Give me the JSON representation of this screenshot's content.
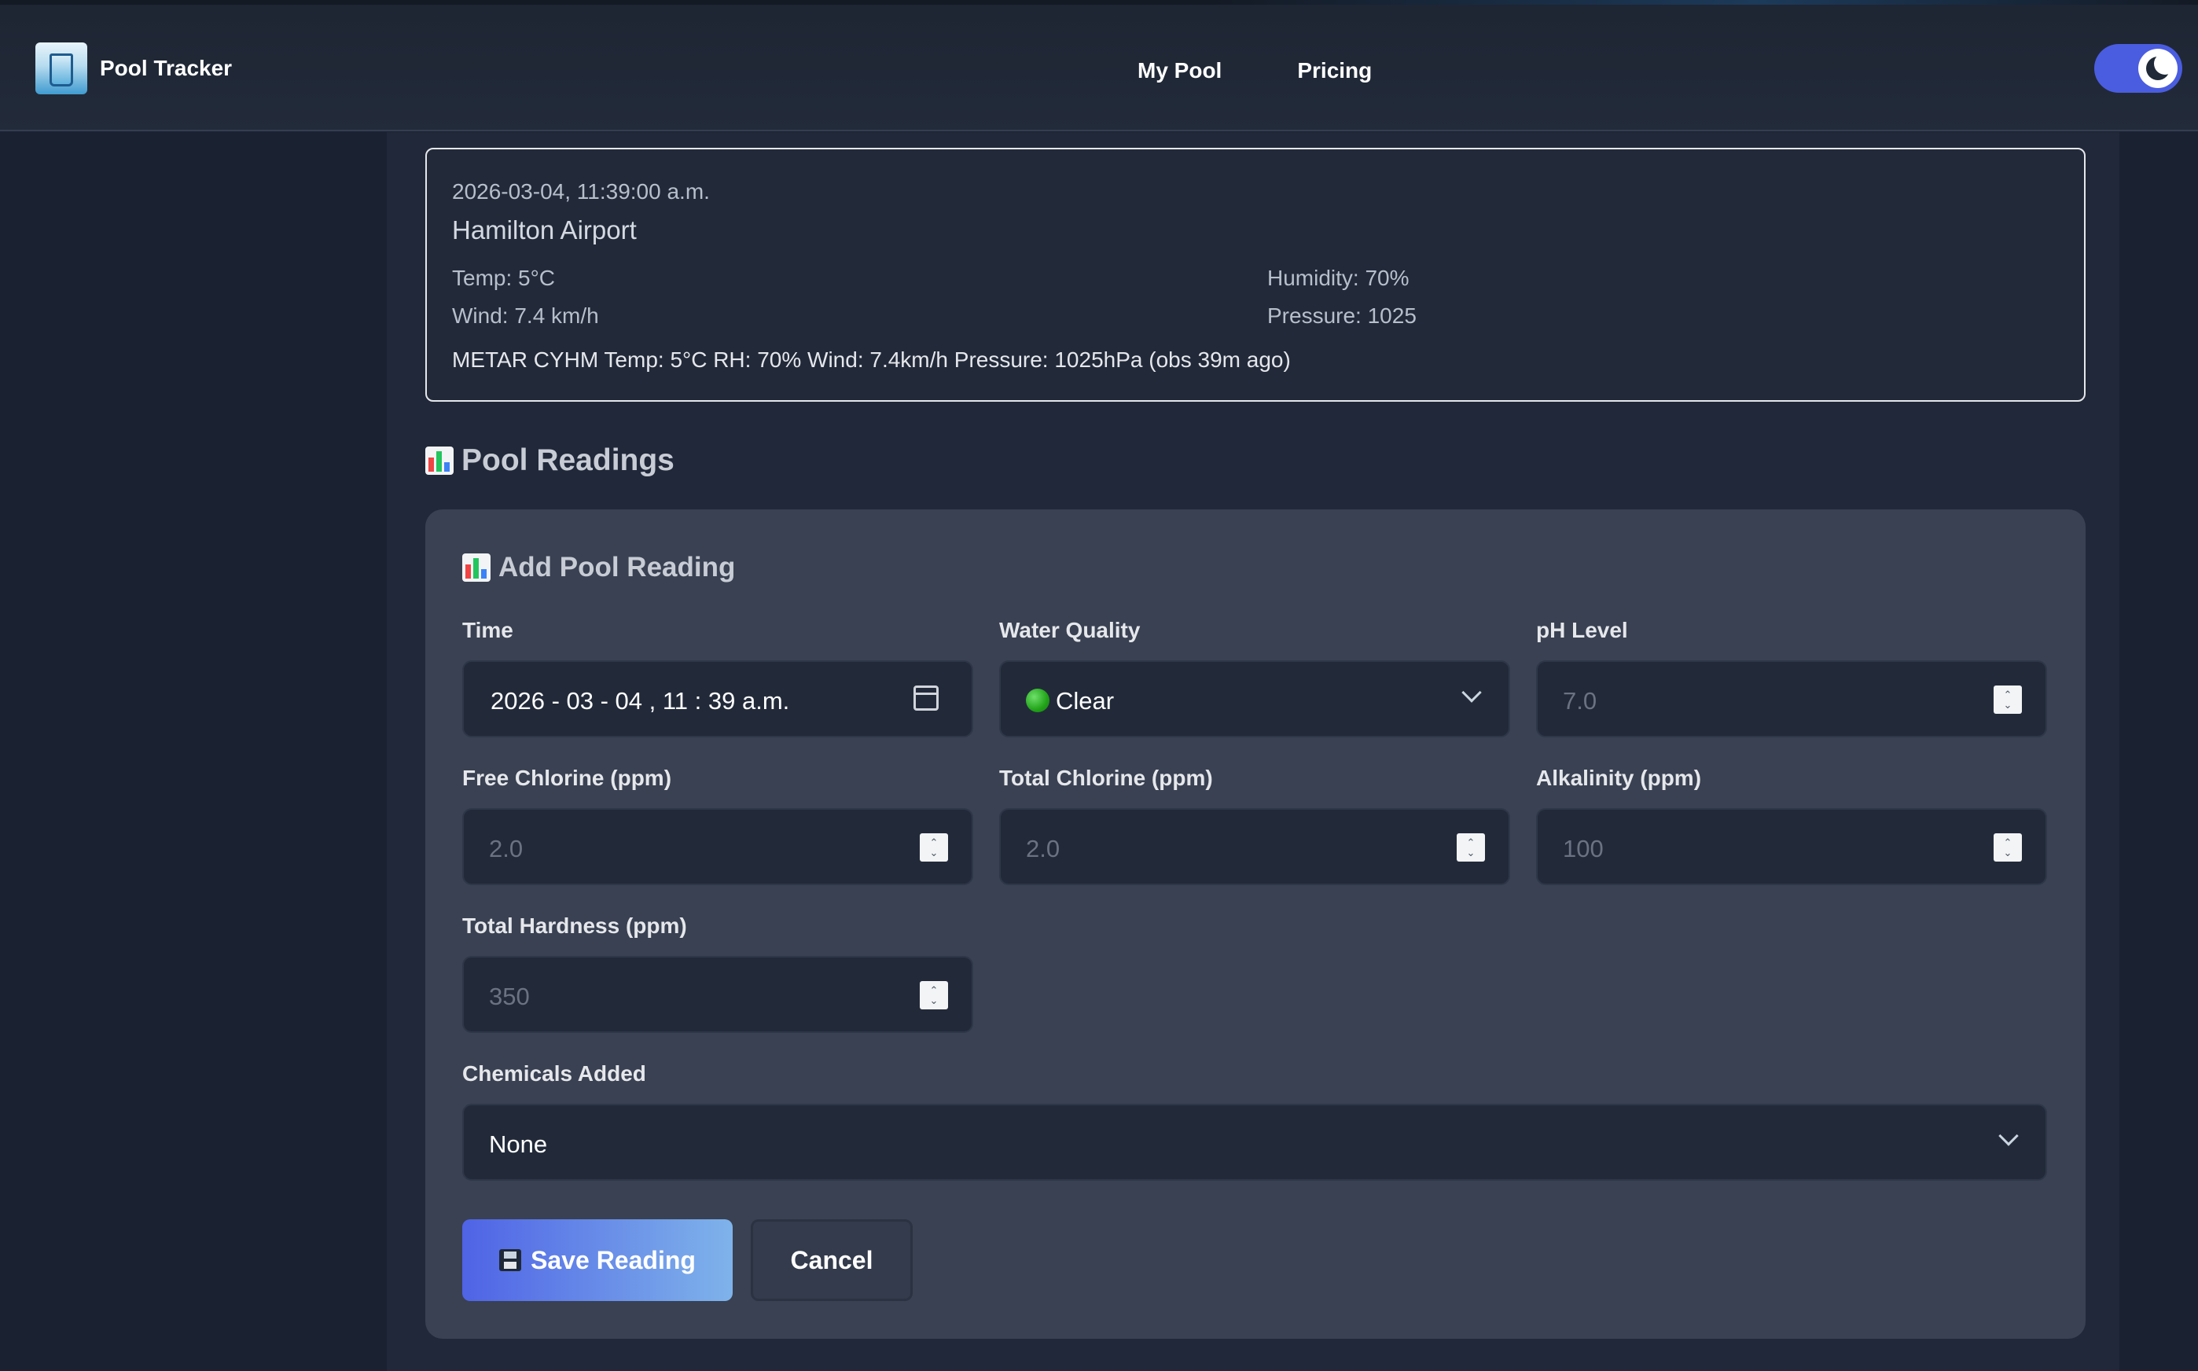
{
  "app": {
    "name": "Pool Tracker"
  },
  "nav": {
    "links": [
      {
        "label": "My Pool"
      },
      {
        "label": "Pricing"
      }
    ],
    "theme_toggle": "dark"
  },
  "weather": {
    "timestamp": "2026-03-04, 11:39:00 a.m.",
    "location": "Hamilton Airport",
    "temp": "Temp: 5°C",
    "humidity": "Humidity: 70%",
    "wind": "Wind: 7.4 km/h",
    "pressure": "Pressure: 1025",
    "metar": "METAR CYHM Temp: 5°C RH: 70% Wind: 7.4km/h Pressure: 1025hPa (obs 39m ago)"
  },
  "section": {
    "title": "Pool Readings",
    "icon": "bar-chart-icon"
  },
  "form": {
    "title": "Add Pool Reading",
    "time": {
      "label": "Time",
      "value": "2026 - 03 - 04 ,  11 : 39   a.m."
    },
    "water_quality": {
      "label": "Water Quality",
      "value": "Clear"
    },
    "ph": {
      "label": "pH Level",
      "placeholder": "7.0"
    },
    "free_chlorine": {
      "label": "Free Chlorine (ppm)",
      "placeholder": "2.0"
    },
    "total_chlorine": {
      "label": "Total Chlorine (ppm)",
      "placeholder": "2.0"
    },
    "alkalinity": {
      "label": "Alkalinity (ppm)",
      "placeholder": "100"
    },
    "hardness": {
      "label": "Total Hardness (ppm)",
      "placeholder": "350"
    },
    "chemicals": {
      "label": "Chemicals Added",
      "value": "None"
    },
    "save_label": "Save Reading",
    "cancel_label": "Cancel"
  },
  "colors": {
    "accent": "#4f63e6",
    "background": "#1b2333",
    "card": "#394152"
  }
}
